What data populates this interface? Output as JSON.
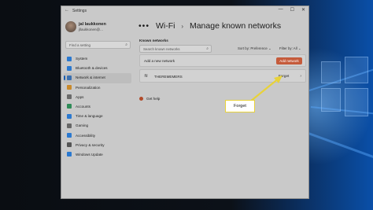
{
  "window": {
    "app_title": "Settings",
    "controls": [
      "—",
      "☐",
      "✕"
    ]
  },
  "user": {
    "name": "jal laukkonen",
    "email": "jllaukkonen@..."
  },
  "sidebar": {
    "search_placeholder": "Find a setting",
    "items": [
      {
        "label": "System",
        "icon": "system-icon",
        "color": "#2b79d0"
      },
      {
        "label": "Bluetooth & devices",
        "icon": "bluetooth-icon",
        "color": "#2b79d0"
      },
      {
        "label": "Network & internet",
        "icon": "network-icon",
        "color": "#3a6fb0",
        "active": true
      },
      {
        "label": "Personalization",
        "icon": "brush-icon",
        "color": "#c98a2c"
      },
      {
        "label": "Apps",
        "icon": "apps-icon",
        "color": "#6a6a6a"
      },
      {
        "label": "Accounts",
        "icon": "accounts-icon",
        "color": "#2e8b57"
      },
      {
        "label": "Time & language",
        "icon": "clock-icon",
        "color": "#2b79d0"
      },
      {
        "label": "Gaming",
        "icon": "gaming-icon",
        "color": "#666"
      },
      {
        "label": "Accessibility",
        "icon": "accessibility-icon",
        "color": "#2b79d0"
      },
      {
        "label": "Privacy & security",
        "icon": "shield-icon",
        "color": "#555"
      },
      {
        "label": "Windows Update",
        "icon": "update-icon",
        "color": "#2b79d0"
      }
    ]
  },
  "breadcrumb": {
    "dots": "•••",
    "parent": "Wi-Fi",
    "separator": "›",
    "current": "Manage known networks"
  },
  "known_networks": {
    "section_label": "Known networks",
    "search_placeholder": "Search known networks",
    "sort_label": "Sort by: Preference ⌄",
    "filter_label": "Filter by: All ⌄",
    "add_label": "Add a new network",
    "add_button": "Add network",
    "networks": [
      {
        "name": "THEREMEMERS",
        "forget_label": "Forget"
      }
    ]
  },
  "help": {
    "label": "Get help"
  },
  "annotation": {
    "callout_text": "Forget",
    "color": "#e8d23a"
  }
}
